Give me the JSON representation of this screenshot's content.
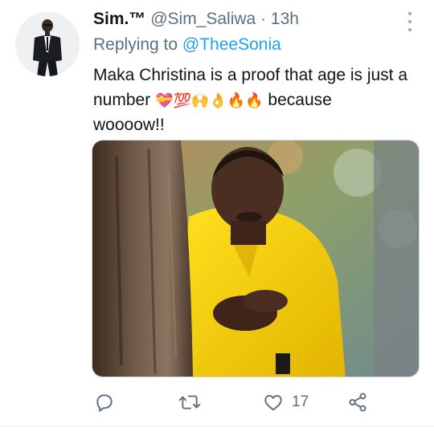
{
  "tweet": {
    "display_name": "Sim.™",
    "handle": "@Sim_Saliwa",
    "separator": "·",
    "time": "13h",
    "replying_prefix": "Replying to ",
    "replying_to": "@TheeSonia",
    "text_line1": "Maka Christina is a proof that age is just a",
    "text_line2_start": "number ",
    "emojis": [
      "💝",
      "💯",
      "🙌",
      "👌",
      "🔥",
      "🔥"
    ],
    "text_line2_end": " because",
    "text_line3": "woooow!!"
  },
  "actions": {
    "reply_icon": "reply-icon",
    "retweet_icon": "retweet-icon",
    "like_icon": "heart-icon",
    "like_count": "17",
    "share_icon": "share-icon"
  },
  "colors": {
    "accent": "#1da1f2",
    "secondary_text": "#5b7083",
    "primary_text": "#0f1419"
  }
}
